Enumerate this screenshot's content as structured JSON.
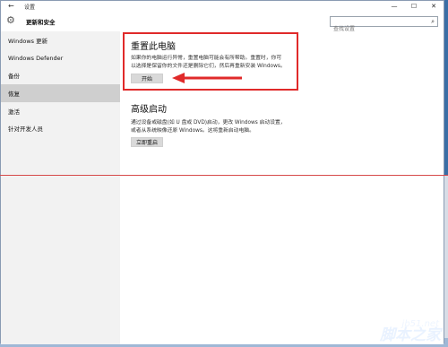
{
  "window": {
    "title": "设置",
    "back_glyph": "←",
    "minimize_glyph": "—",
    "maximize_glyph": "☐",
    "close_glyph": "✕"
  },
  "header": {
    "title": "更新和安全",
    "gear_glyph": "⚙"
  },
  "search": {
    "placeholder": "查找设置",
    "icon_glyph": "⌕"
  },
  "sidebar": {
    "items": [
      {
        "label": "Windows 更新"
      },
      {
        "label": "Windows Defender"
      },
      {
        "label": "备份"
      },
      {
        "label": "恢复"
      },
      {
        "label": "激活"
      },
      {
        "label": "针对开发人员"
      }
    ],
    "active_index": 3
  },
  "reset": {
    "title": "重置此电脑",
    "desc1": "如果你的电脑运行异常，重置电脑可能会有所帮助。重置时，你可",
    "desc2": "以选择是保留你的文件还是删除它们，然后再重新安装 Windows。",
    "button": "开始"
  },
  "advanced": {
    "title": "高级启动",
    "desc1": "通过设备或磁盘(如 U 盘或 DVD)启动，更改 Windows 启动设置，",
    "desc2": "或者从系统映像还原 Windows。这将重新启动电脑。",
    "button": "立即重启"
  },
  "watermark": {
    "url": "jb51.net",
    "logo": "脚本之家"
  },
  "colors": {
    "annotation_red": "#e02a2a",
    "active_bg": "#cfcfcf"
  }
}
